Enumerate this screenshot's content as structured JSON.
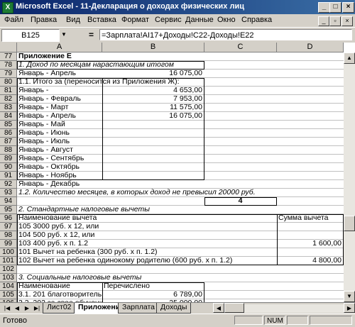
{
  "window": {
    "title": "Microsoft Excel - 11-Декларация о доходах физических лиц"
  },
  "menu": [
    "Файл",
    "Правка",
    "Вид",
    "Вставка",
    "Формат",
    "Сервис",
    "Данные",
    "Окно",
    "Справка"
  ],
  "formula_bar": {
    "name_box": "B125",
    "eq": "=",
    "formula": "=Зарплата!AI17+Доходы!C22-Доходы!E22"
  },
  "columns": [
    "A",
    "B",
    "C",
    "D"
  ],
  "rows": [
    {
      "n": "77",
      "a": "Приложение Е",
      "a_style": "bold"
    },
    {
      "n": "78",
      "a": "1. Доход по месяцам нарастающим итогом",
      "a_style": "ital"
    },
    {
      "n": "79",
      "a": "Январь - Апрель",
      "b": "16 075,00"
    },
    {
      "n": "80",
      "a": "1.1. Итого за (переносится из Приложения Ж):"
    },
    {
      "n": "81",
      "a": "Январь -",
      "b": "4 653,00"
    },
    {
      "n": "82",
      "a": "Январь - Февраль",
      "b": "7 953,00"
    },
    {
      "n": "83",
      "a": "Январь - Март",
      "b": "11 575,00"
    },
    {
      "n": "84",
      "a": "Январь - Апрель",
      "b": "16 075,00"
    },
    {
      "n": "85",
      "a": "Январь - Май"
    },
    {
      "n": "86",
      "a": "Январь - Июнь"
    },
    {
      "n": "87",
      "a": "Январь - Июль"
    },
    {
      "n": "88",
      "a": "Январь - Август"
    },
    {
      "n": "89",
      "a": "Январь - Сентябрь"
    },
    {
      "n": "90",
      "a": "Январь - Октябрь"
    },
    {
      "n": "91",
      "a": "Январь - Ноябрь"
    },
    {
      "n": "92",
      "a": "Январь - Декабрь"
    },
    {
      "n": "93",
      "a": "1.2. Количество месяцев, в которых доход не превысил 20000 руб.",
      "a_style": "ital"
    },
    {
      "n": "94",
      "c": "4"
    },
    {
      "n": "95",
      "a": "2. Стандартные налоговые вычеты",
      "a_style": "ital"
    },
    {
      "n": "96",
      "a": "Наименование вычета",
      "d": "Сумма вычета"
    },
    {
      "n": "97",
      "a": "105    3000 руб. х 12, или"
    },
    {
      "n": "98",
      "a": "104      500 руб. х 12, или"
    },
    {
      "n": "99",
      "a": "103      400 руб. х п. 1.2",
      "d": "1 600,00"
    },
    {
      "n": "100",
      "a": "101      Вычет на ребенка (300 руб. х п. 1.2)"
    },
    {
      "n": "101",
      "a": "102      Вычет на ребенка одинокому родителю (600 руб. х п. 1.2)",
      "d": "4 800,00"
    },
    {
      "n": "102"
    },
    {
      "n": "103",
      "a": "3. Социальные налоговые вычеты",
      "a_style": "ital"
    },
    {
      "n": "104",
      "a": "Наименование",
      "b": "Перечислено"
    },
    {
      "n": "105",
      "a": "3.1. 201  благотворитель",
      "b": "6 789,00"
    },
    {
      "n": "106",
      "a": "3.2. 202  за свое обучени",
      "b": "25 000,00"
    }
  ],
  "sheet_tabs": [
    "Лист02",
    "Приложения",
    "Зарплата",
    "Доходы"
  ],
  "active_tab": "Приложения",
  "status": {
    "text": "Готово",
    "num": "NUM"
  }
}
